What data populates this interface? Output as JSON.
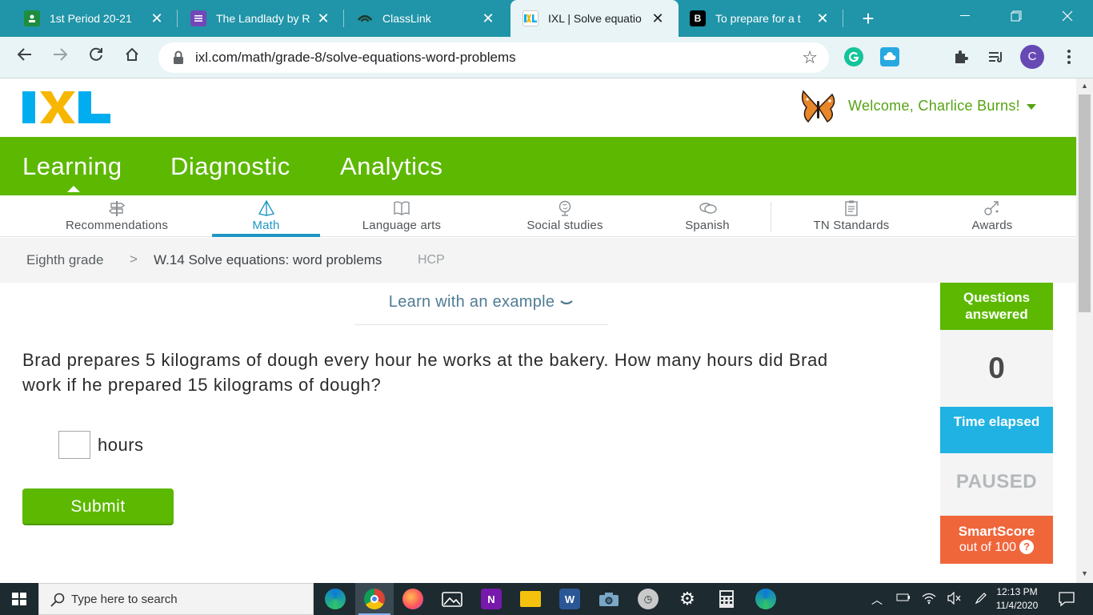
{
  "browser": {
    "tabs": [
      {
        "title": "1st Period 20-21",
        "favicon": "google-classroom-icon",
        "active": false
      },
      {
        "title": "The Landlady by R",
        "favicon": "google-forms-icon",
        "active": false
      },
      {
        "title": "ClassLink",
        "favicon": "classlink-icon",
        "active": false
      },
      {
        "title": "IXL | Solve equatio",
        "favicon": "ixl-icon",
        "active": true
      },
      {
        "title": "To prepare for a t",
        "favicon": "brainly-icon",
        "active": false
      }
    ],
    "new_tab_label": "+",
    "url": "ixl.com/math/grade-8/solve-equations-word-problems",
    "profile_initial": "C"
  },
  "header": {
    "logo_text": "IXL",
    "welcome": "Welcome, Charlice Burns!"
  },
  "nav": {
    "main_tabs": [
      "Learning",
      "Diagnostic",
      "Analytics"
    ],
    "subjects": [
      "Recommendations",
      "Math",
      "Language arts",
      "Social studies",
      "Spanish",
      "TN Standards",
      "Awards"
    ],
    "active_subject": "Math"
  },
  "breadcrumb": {
    "grade": "Eighth grade",
    "separator": ">",
    "skill": "W.14 Solve equations: word problems",
    "tag": "HCP"
  },
  "practice": {
    "learn_link": "Learn with an example",
    "question": "Brad prepares 5 kilograms of dough every hour he works at the bakery. How many hours did Brad work if he prepared 15 kilograms of dough?",
    "answer_value": "",
    "answer_unit": "hours",
    "submit_label": "Submit"
  },
  "sidebar": {
    "questions_answered_label": "Questions answered",
    "questions_answered_value": "0",
    "time_elapsed_label": "Time elapsed",
    "time_elapsed_value": "PAUSED",
    "smartscore_label": "SmartScore",
    "smartscore_sub": "out of 100",
    "help_glyph": "?"
  },
  "taskbar": {
    "search_placeholder": "Type here to search",
    "time": "12:13 PM",
    "date": "11/4/2020"
  },
  "colors": {
    "ixl_green": "#5cb800",
    "ixl_blue": "#20b2e2",
    "smartscore_orange": "#f0663b",
    "chrome_tab_strip": "#2094a8"
  }
}
